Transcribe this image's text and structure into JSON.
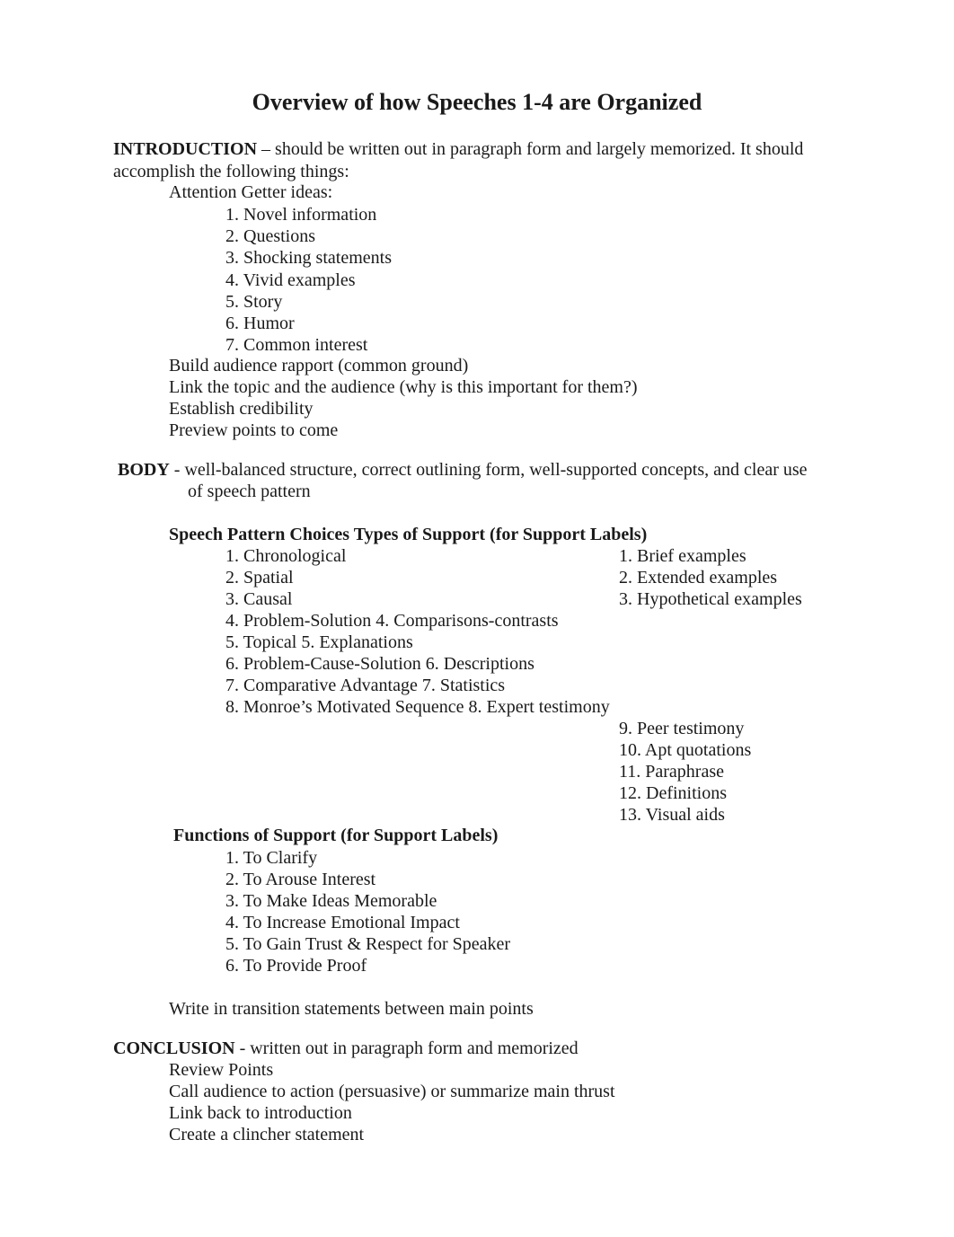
{
  "title": "Overview of how Speeches 1-4 are Organized",
  "introduction": {
    "heading": "INTRODUCTION",
    "text_line1": " – should be written out in paragraph form and largely memorized. It should",
    "text_line2": "accomplish the following things:",
    "attention_label": "Attention Getter ideas:",
    "attention_items": [
      "1. Novel information",
      "2. Questions",
      "3. Shocking statements",
      "4. Vivid examples",
      "5. Story",
      "6. Humor",
      "7. Common interest"
    ],
    "goals": [
      "Build audience rapport (common ground)",
      "Link the topic and the audience (why is this important for them?)",
      "Establish credibility",
      "Preview points to come"
    ]
  },
  "body": {
    "heading": "BODY",
    "text_line1": " - well-balanced structure, correct outlining form, well-supported concepts, and clear use",
    "text_line2": "of speech pattern",
    "patterns_heading": "Speech Pattern Choices Types of Support (for Support Labels)",
    "left_column": [
      "1. Chronological",
      "2. Spatial",
      "3. Causal",
      "4. Problem-Solution 4. Comparisons-contrasts",
      "5. Topical 5. Explanations",
      "6. Problem-Cause-Solution 6. Descriptions",
      "7. Comparative Advantage 7. Statistics",
      "8. Monroe’s Motivated Sequence 8. Expert testimony"
    ],
    "right_column_top": [
      "1. Brief examples",
      "2. Extended examples",
      "3. Hypothetical examples"
    ],
    "right_column_bottom": [
      "9. Peer testimony",
      "10. Apt quotations",
      "11. Paraphrase",
      "12. Definitions",
      "13. Visual aids"
    ],
    "functions_heading": "Functions of Support (for Support Labels)",
    "functions": [
      "1. To Clarify",
      "2. To Arouse Interest",
      "3. To Make Ideas Memorable",
      "4. To Increase Emotional Impact",
      "5. To Gain Trust & Respect for Speaker",
      "6. To Provide Proof"
    ],
    "transitions": "Write in transition statements between main points"
  },
  "conclusion": {
    "heading": "CONCLUSION",
    "text": " - written out in paragraph form and memorized",
    "items": [
      "Review Points",
      "Call audience to action (persuasive) or summarize main thrust",
      "Link back to introduction",
      "Create a clincher statement"
    ]
  }
}
